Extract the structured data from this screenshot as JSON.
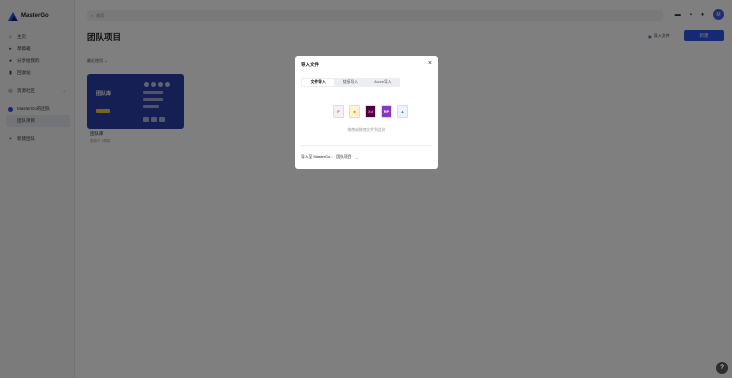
{
  "app": {
    "name": "MasterGo"
  },
  "sidebar": {
    "items": [
      {
        "label": "主页",
        "icon": "home-icon"
      },
      {
        "label": "草稿箱",
        "icon": "cursor-icon"
      },
      {
        "label": "分享给我的",
        "icon": "user-icon"
      },
      {
        "label": "回收站",
        "icon": "trash-icon"
      },
      {
        "label": "资源社区",
        "icon": "community-icon"
      },
      {
        "label": "MasterGo的团队",
        "icon": "team-icon"
      },
      {
        "label": "团队项目",
        "icon": ""
      },
      {
        "label": "新建团队",
        "icon": "plus-icon"
      }
    ]
  },
  "search": {
    "placeholder": "搜索"
  },
  "header": {
    "title": "团队项目",
    "import_file": "导入文件",
    "new_button": "新建"
  },
  "sort": {
    "label": "最近使用 ⌄"
  },
  "card": {
    "cover_title": "团队库",
    "name": "团队库",
    "meta": "更新于 2周前"
  },
  "modal": {
    "title": "导入文件",
    "close": "×",
    "tabs": [
      {
        "label": "文件导入",
        "active": true
      },
      {
        "label": "链接导入",
        "active": false
      },
      {
        "label": "Axure导入",
        "active": false
      }
    ],
    "file_types": [
      {
        "name": "figma-file-icon",
        "glyph": "F",
        "color": "#f2f2f2",
        "text": "#e54e2b"
      },
      {
        "name": "sketch-file-icon",
        "glyph": "◆",
        "color": "#fff3d6",
        "text": "#f7a800"
      },
      {
        "name": "xd-file-icon",
        "glyph": "Xd",
        "color": "#470137",
        "text": "#ff61f6"
      },
      {
        "name": "axure-file-icon",
        "glyph": "RP",
        "color": "#8a37c2",
        "text": "#ffffff"
      },
      {
        "name": "image-file-icon",
        "glyph": "▲",
        "color": "#eef2fb",
        "text": "#4b72d9"
      }
    ],
    "drop_hint": "拖拽或拖拽文件到此处",
    "footer_prefix": "导入至 MasterGo...",
    "footer_target": "团队项目",
    "footer_arrow": "→"
  },
  "help": {
    "label": "?"
  },
  "colors": {
    "accent": "#2a55e5",
    "card": "#2b3fa8"
  }
}
